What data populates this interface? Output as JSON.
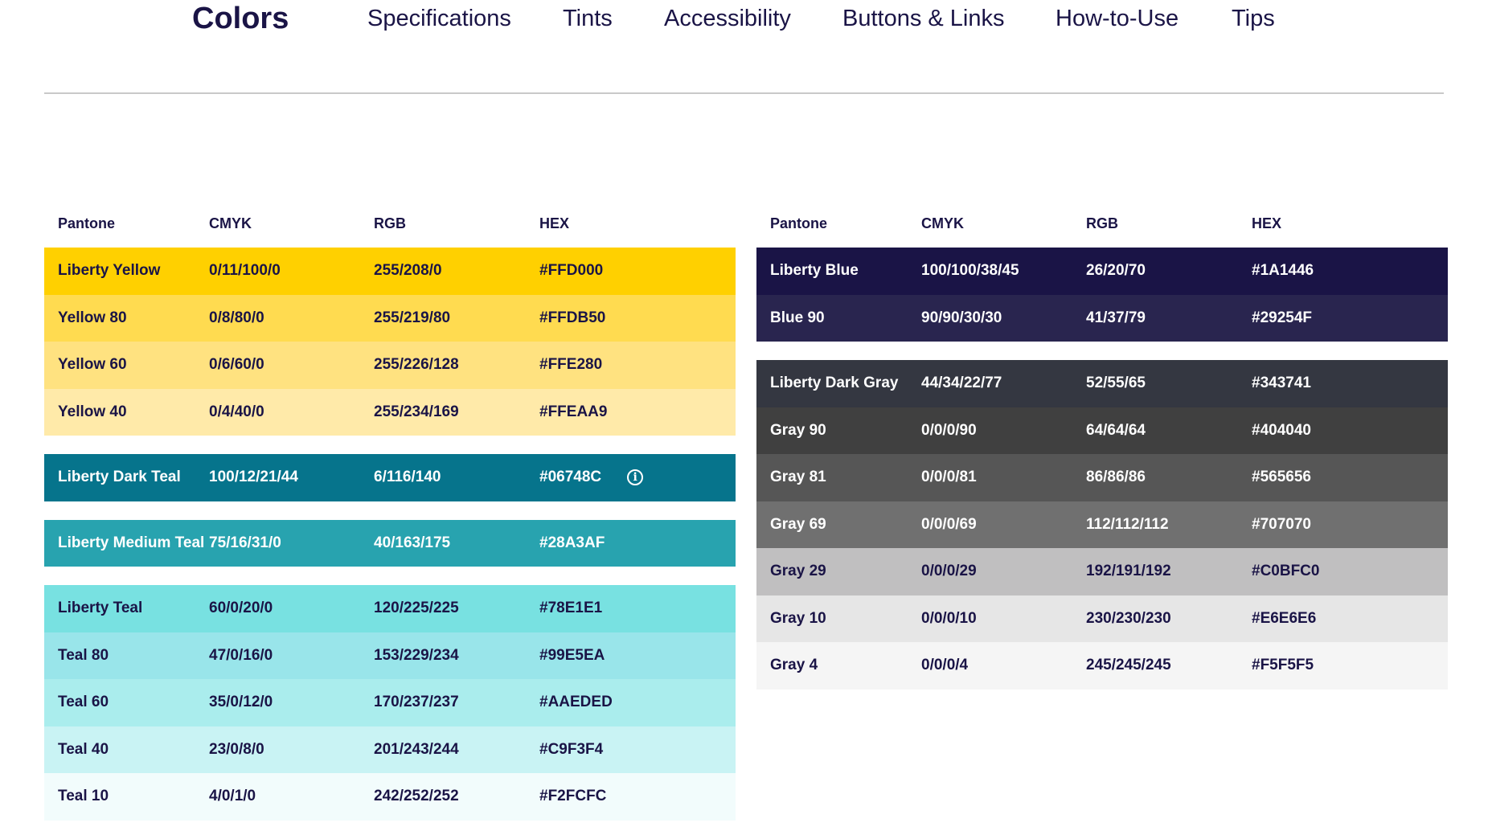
{
  "nav": {
    "brand": "Colors",
    "links": [
      "Specifications",
      "Tints",
      "Accessibility",
      "Buttons & Links",
      "How-to-Use",
      "Tips"
    ]
  },
  "columns": [
    "Pantone",
    "CMYK",
    "RGB",
    "HEX"
  ],
  "info_icon": "info-icon",
  "left_groups": [
    {
      "rows": [
        {
          "name": "Liberty Yellow",
          "cmyk": "0/11/100/0",
          "rgb": "255/208/0",
          "hex": "#FFD000",
          "bg": "#FFD000",
          "fg": "#1A1446"
        },
        {
          "name": "Yellow 80",
          "cmyk": "0/8/80/0",
          "rgb": "255/219/80",
          "hex": "#FFDB50",
          "bg": "#FFDB50",
          "fg": "#1A1446"
        },
        {
          "name": "Yellow 60",
          "cmyk": "0/6/60/0",
          "rgb": "255/226/128",
          "hex": "#FFE280",
          "bg": "#FFE280",
          "fg": "#1A1446"
        },
        {
          "name": "Yellow 40",
          "cmyk": "0/4/40/0",
          "rgb": "255/234/169",
          "hex": "#FFEAA9",
          "bg": "#FFEAA9",
          "fg": "#1A1446"
        }
      ]
    },
    {
      "rows": [
        {
          "name": "Liberty Dark Teal",
          "cmyk": "100/12/21/44",
          "rgb": "6/116/140",
          "hex": "#06748C",
          "bg": "#06748C",
          "fg": "#FFFFFF",
          "info": true
        }
      ]
    },
    {
      "rows": [
        {
          "name": "Liberty Medium Teal",
          "cmyk": "75/16/31/0",
          "rgb": "40/163/175",
          "hex": "#28A3AF",
          "bg": "#28A3AF",
          "fg": "#FFFFFF"
        }
      ]
    },
    {
      "rows": [
        {
          "name": "Liberty Teal",
          "cmyk": "60/0/20/0",
          "rgb": "120/225/225",
          "hex": "#78E1E1",
          "bg": "#78E1E1",
          "fg": "#1A1446"
        },
        {
          "name": "Teal 80",
          "cmyk": "47/0/16/0",
          "rgb": "153/229/234",
          "hex": "#99E5EA",
          "bg": "#99E5EA",
          "fg": "#1A1446"
        },
        {
          "name": "Teal 60",
          "cmyk": "35/0/12/0",
          "rgb": "170/237/237",
          "hex": "#AAEDED",
          "bg": "#AAEDED",
          "fg": "#1A1446"
        },
        {
          "name": "Teal 40",
          "cmyk": "23/0/8/0",
          "rgb": "201/243/244",
          "hex": "#C9F3F4",
          "bg": "#C9F3F4",
          "fg": "#1A1446"
        },
        {
          "name": "Teal 10",
          "cmyk": "4/0/1/0",
          "rgb": "242/252/252",
          "hex": "#F2FCFC",
          "bg": "#F2FCFC",
          "fg": "#1A1446"
        }
      ]
    }
  ],
  "right_groups": [
    {
      "rows": [
        {
          "name": "Liberty Blue",
          "cmyk": "100/100/38/45",
          "rgb": "26/20/70",
          "hex": "#1A1446",
          "bg": "#1A1446",
          "fg": "#FFFFFF"
        },
        {
          "name": "Blue 90",
          "cmyk": "90/90/30/30",
          "rgb": "41/37/79",
          "hex": "#29254F",
          "bg": "#29254F",
          "fg": "#FFFFFF"
        }
      ]
    },
    {
      "rows": [
        {
          "name": "Liberty Dark Gray",
          "cmyk": "44/34/22/77",
          "rgb": "52/55/65",
          "hex": "#343741",
          "bg": "#343741",
          "fg": "#FFFFFF"
        },
        {
          "name": "Gray 90",
          "cmyk": "0/0/0/90",
          "rgb": "64/64/64",
          "hex": "#404040",
          "bg": "#404040",
          "fg": "#FFFFFF"
        },
        {
          "name": "Gray 81",
          "cmyk": "0/0/0/81",
          "rgb": "86/86/86",
          "hex": "#565656",
          "bg": "#565656",
          "fg": "#FFFFFF"
        },
        {
          "name": "Gray 69",
          "cmyk": "0/0/0/69",
          "rgb": "112/112/112",
          "hex": "#707070",
          "bg": "#707070",
          "fg": "#FFFFFF"
        },
        {
          "name": "Gray 29",
          "cmyk": "0/0/0/29",
          "rgb": "192/191/192",
          "hex": "#C0BFC0",
          "bg": "#C0BFC0",
          "fg": "#1A1446"
        },
        {
          "name": "Gray 10",
          "cmyk": "0/0/0/10",
          "rgb": "230/230/230",
          "hex": "#E6E6E6",
          "bg": "#E6E6E6",
          "fg": "#1A1446"
        },
        {
          "name": "Gray 4",
          "cmyk": "0/0/0/4",
          "rgb": "245/245/245",
          "hex": "#F5F5F5",
          "bg": "#F5F5F5",
          "fg": "#1A1446"
        }
      ]
    }
  ]
}
